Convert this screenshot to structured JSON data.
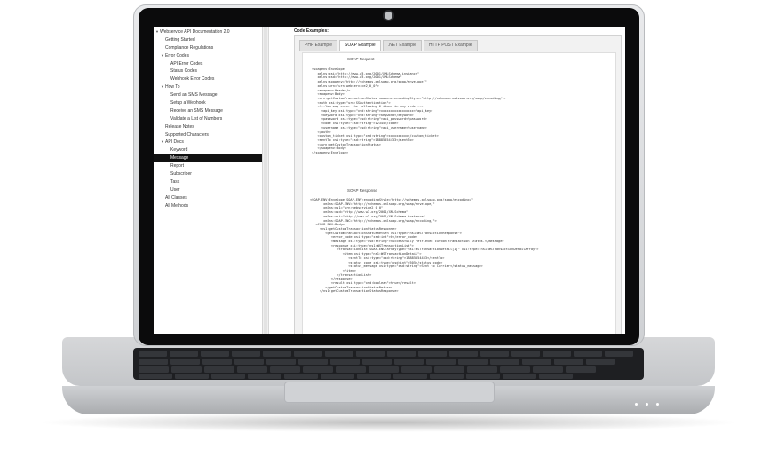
{
  "sidebar": {
    "tree": [
      {
        "label": "Webservice API Documentation 2.0",
        "caret": "▼",
        "level": 0,
        "selected": false
      },
      {
        "label": "Getting Started",
        "caret": "",
        "level": 1,
        "selected": false
      },
      {
        "label": "Compliance Regulations",
        "caret": "",
        "level": 1,
        "selected": false
      },
      {
        "label": "Error Codes",
        "caret": "▼",
        "level": 1,
        "selected": false
      },
      {
        "label": "API Error Codes",
        "caret": "",
        "level": 2,
        "selected": false
      },
      {
        "label": "Status Codes",
        "caret": "",
        "level": 2,
        "selected": false
      },
      {
        "label": "Webhook Error Codes",
        "caret": "",
        "level": 2,
        "selected": false
      },
      {
        "label": "How To",
        "caret": "▼",
        "level": 1,
        "selected": false
      },
      {
        "label": "Send an SMS Message",
        "caret": "",
        "level": 2,
        "selected": false
      },
      {
        "label": "Setup a Webhook",
        "caret": "",
        "level": 2,
        "selected": false
      },
      {
        "label": "Receive an SMS Message",
        "caret": "",
        "level": 2,
        "selected": false
      },
      {
        "label": "Validate a List of Numbers",
        "caret": "",
        "level": 2,
        "selected": false
      },
      {
        "label": "Release Notes",
        "caret": "",
        "level": 1,
        "selected": false
      },
      {
        "label": "Supported Characters",
        "caret": "",
        "level": 1,
        "selected": false
      },
      {
        "label": "API Docs",
        "caret": "▼",
        "level": 1,
        "selected": false
      },
      {
        "label": "Keyword",
        "caret": "",
        "level": 2,
        "selected": false
      },
      {
        "label": "Message",
        "caret": "",
        "level": 2,
        "selected": true
      },
      {
        "label": "Report",
        "caret": "",
        "level": 2,
        "selected": false
      },
      {
        "label": "Subscriber",
        "caret": "",
        "level": 2,
        "selected": false
      },
      {
        "label": "Task",
        "caret": "",
        "level": 2,
        "selected": false
      },
      {
        "label": "User",
        "caret": "",
        "level": 2,
        "selected": false
      },
      {
        "label": "All Classes",
        "caret": "",
        "level": 1,
        "selected": false
      },
      {
        "label": "All Methods",
        "caret": "",
        "level": 1,
        "selected": false
      }
    ]
  },
  "content": {
    "title": "Code Examples:",
    "tabs": [
      "PHP Example",
      "SOAP Example",
      ".NET Example",
      "HTTP POST Example"
    ],
    "active_tab": "SOAP Example",
    "request_heading": "SOAP Request",
    "request_code": "<soapenv:Envelope\n   xmlns:xsi=\"http://www.w3.org/2001/XMLSchema-instance\"\n   xmlns:xsd=\"http://www.w3.org/2001/XMLSchema\"\n   xmlns:soapenv=\"http://schemas.xmlsoap.org/soap/envelope/\"\n   xmlns:urn=\"urn:webservice2_0_0\">\n   <soapenv:Header/>\n   <soapenv:Body>\n   <urn:getCustomTransactionStatus soapenv:encodingStyle=\"http://schemas.xmlsoap.org/soap/encoding/\">\n   <auth xsi:type=\"urn:SSAuthentication\">\n   <!--You may enter the following 6 items in any order-->\n     <api_key xsi:type=\"xsd:string\">xxxxxxxxxxxxxxxxx</api_key>\n     <keyword xsi:type=\"xsd:string\">keyword</keyword>\n     <password xsi:type=\"xsd:string\">api_password</password>\n     <code xsi:type=\"xsd:string\">12345</code>\n     <username xsi:type=\"xsd:string\">api_username</username>\n   </auth>\n   <custom_ticket xsi:type=\"xsd:string\">xxxxxxxxxx</custom_ticket>\n   <sentTo xsi:type=\"xsd:string\">18885554433</sentTo>\n   </urn:getCustomTransactionStatus>\n   </soapenv:Body>\n</soapenv:Envelope>",
    "response_heading": "SOAP Response",
    "response_code": "<SOAP-ENV:Envelope SOAP-ENV:encodingStyle=\"http://schemas.xmlsoap.org/soap/encoding/\"\n       xmlns:SOAP-ENV=\"http://schemas.xmlsoap.org/soap/envelope/\"\n       xmlns:ns1=\"urn:webservice2_0_0\"\n       xmlns:xsd=\"http://www.w3.org/2001/XMLSchema\"\n       xmlns:xsi=\"http://www.w3.org/2001/XMLSchema-instance\"\n       xmlns:SOAP-ENC=\"http://schemas.xmlsoap.org/soap/encoding/\">\n   <SOAP-ENV:Body>\n     <ns1:getCustomTransactionStatusResponse>\n        <getCustomTransactionStatusReturn xsi:type=\"ns1:WSTransactionResponse\">\n           <error_code xsi:type=\"xsd:int\">0</error_code>\n           <message xsi:type=\"xsd:string\">Successfully retrieved custom transaction status.</message>\n           <response xsi:type=\"ns1:WSTransactionList\">\n              <transactionList SOAP-ENC:arrayType=\"ns1:WSTransactionDetail[1]\" xsi:type=\"ns1:WSTransactionDetailArray\">\n                 <item xsi:type=\"ns1:WSTransactionDetail\">\n                    <sentTo xsi:type=\"xsd:string\">18885554433</sentTo>\n                    <status_code xsi:type=\"xsd:int\">505</status_code>\n                    <status_message xsi:type=\"xsd:string\">Sent to Carrier</status_message>\n                 </item>\n              </transactionList>\n           </response>\n           <result xsi:type=\"xsd:boolean\">true</result>\n        </getCustomTransactionStatusReturn>\n     </ns1:getCustomTransactionStatusResponse>"
  }
}
